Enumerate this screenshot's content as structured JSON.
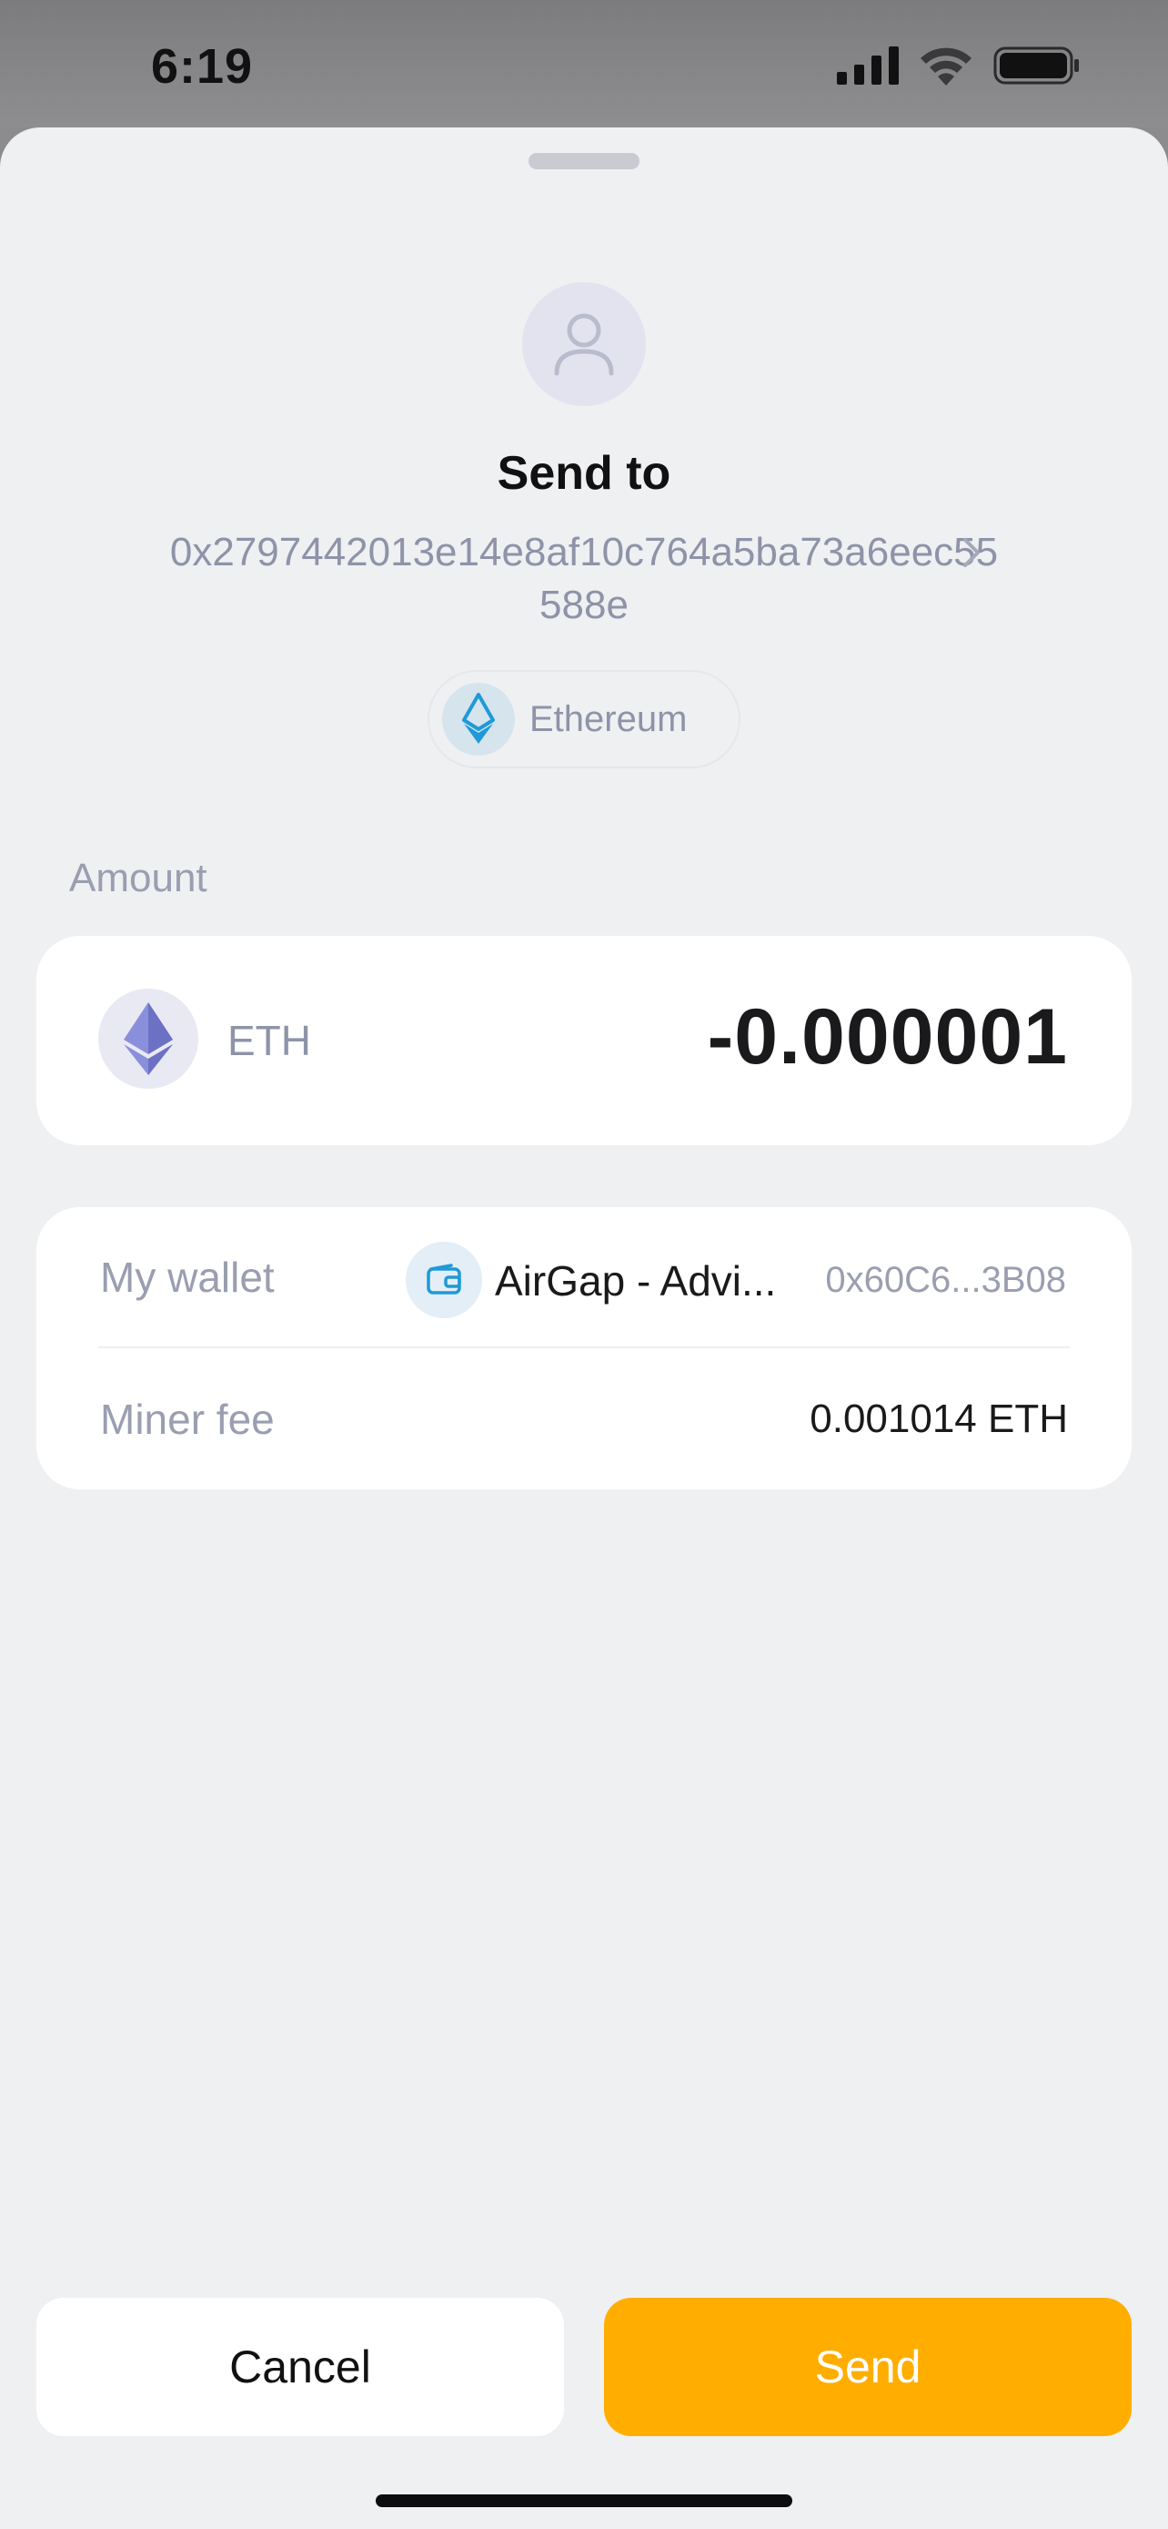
{
  "status_bar": {
    "time": "6:19",
    "icons": [
      "cellular-signal-icon",
      "wifi-icon",
      "battery-icon"
    ]
  },
  "header": {
    "avatar_icon": "person-icon",
    "title": "Send to",
    "address": "0x2797442013e14e8af10c764a5ba73a6eec55588e",
    "network": {
      "icon": "ethereum-icon",
      "label": "Ethereum"
    }
  },
  "amount": {
    "label": "Amount",
    "token_icon": "ethereum-icon",
    "token_symbol": "ETH",
    "value": "-0.000001"
  },
  "details": {
    "wallet_label": "My wallet",
    "wallet_icon": "wallet-icon",
    "wallet_name": "AirGap - Advi...",
    "wallet_address": "0x60C6...3B08",
    "fee_label": "Miner fee",
    "fee_value": "0.001014 ETH"
  },
  "actions": {
    "cancel_label": "Cancel",
    "send_label": "Send"
  },
  "colors": {
    "accent": "#ffae00",
    "background": "#eff0f2",
    "muted_text": "#8e93a8",
    "ethereum_blue": "#1f9ad6",
    "ethereum_purple": "#7b80d4"
  }
}
